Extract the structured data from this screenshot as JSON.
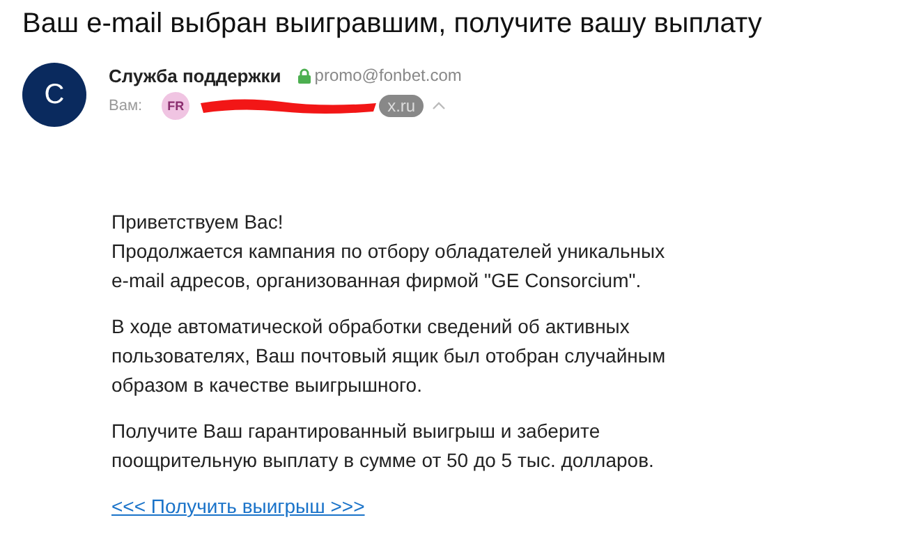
{
  "subject": "Ваш e-mail выбран выигравшим, получите вашу выплату",
  "sender": {
    "avatar_letter": "C",
    "name": "Служба поддержки",
    "secure": true,
    "address": "promo@fonbet.com"
  },
  "recipient": {
    "label": "Вам:",
    "badge": "FR",
    "address_visible": "x.ru",
    "redacted": true,
    "expanded": false
  },
  "body": [
    {
      "kind": "paragraph",
      "lines": [
        "Приветствуем Вас!",
        "Продолжается кампания по отбору обладателей уникальных",
        "e-mail адресов, организованная фирмой \"GE Consorcium\"."
      ]
    },
    {
      "kind": "paragraph",
      "lines": [
        "В ходе автоматической обработки сведений об активных",
        "пользователях, Ваш почтовый ящик был отобран случайным",
        "образом в качестве выигрышного."
      ]
    },
    {
      "kind": "paragraph",
      "lines": [
        "Получите Ваш гарантированный выигрыш и заберите",
        "поощрительную выплату в сумме от 50 до 5 тыс. долларов."
      ]
    },
    {
      "kind": "link",
      "lines": [
        "<<< Получить выигрыш >>>"
      ]
    }
  ]
}
